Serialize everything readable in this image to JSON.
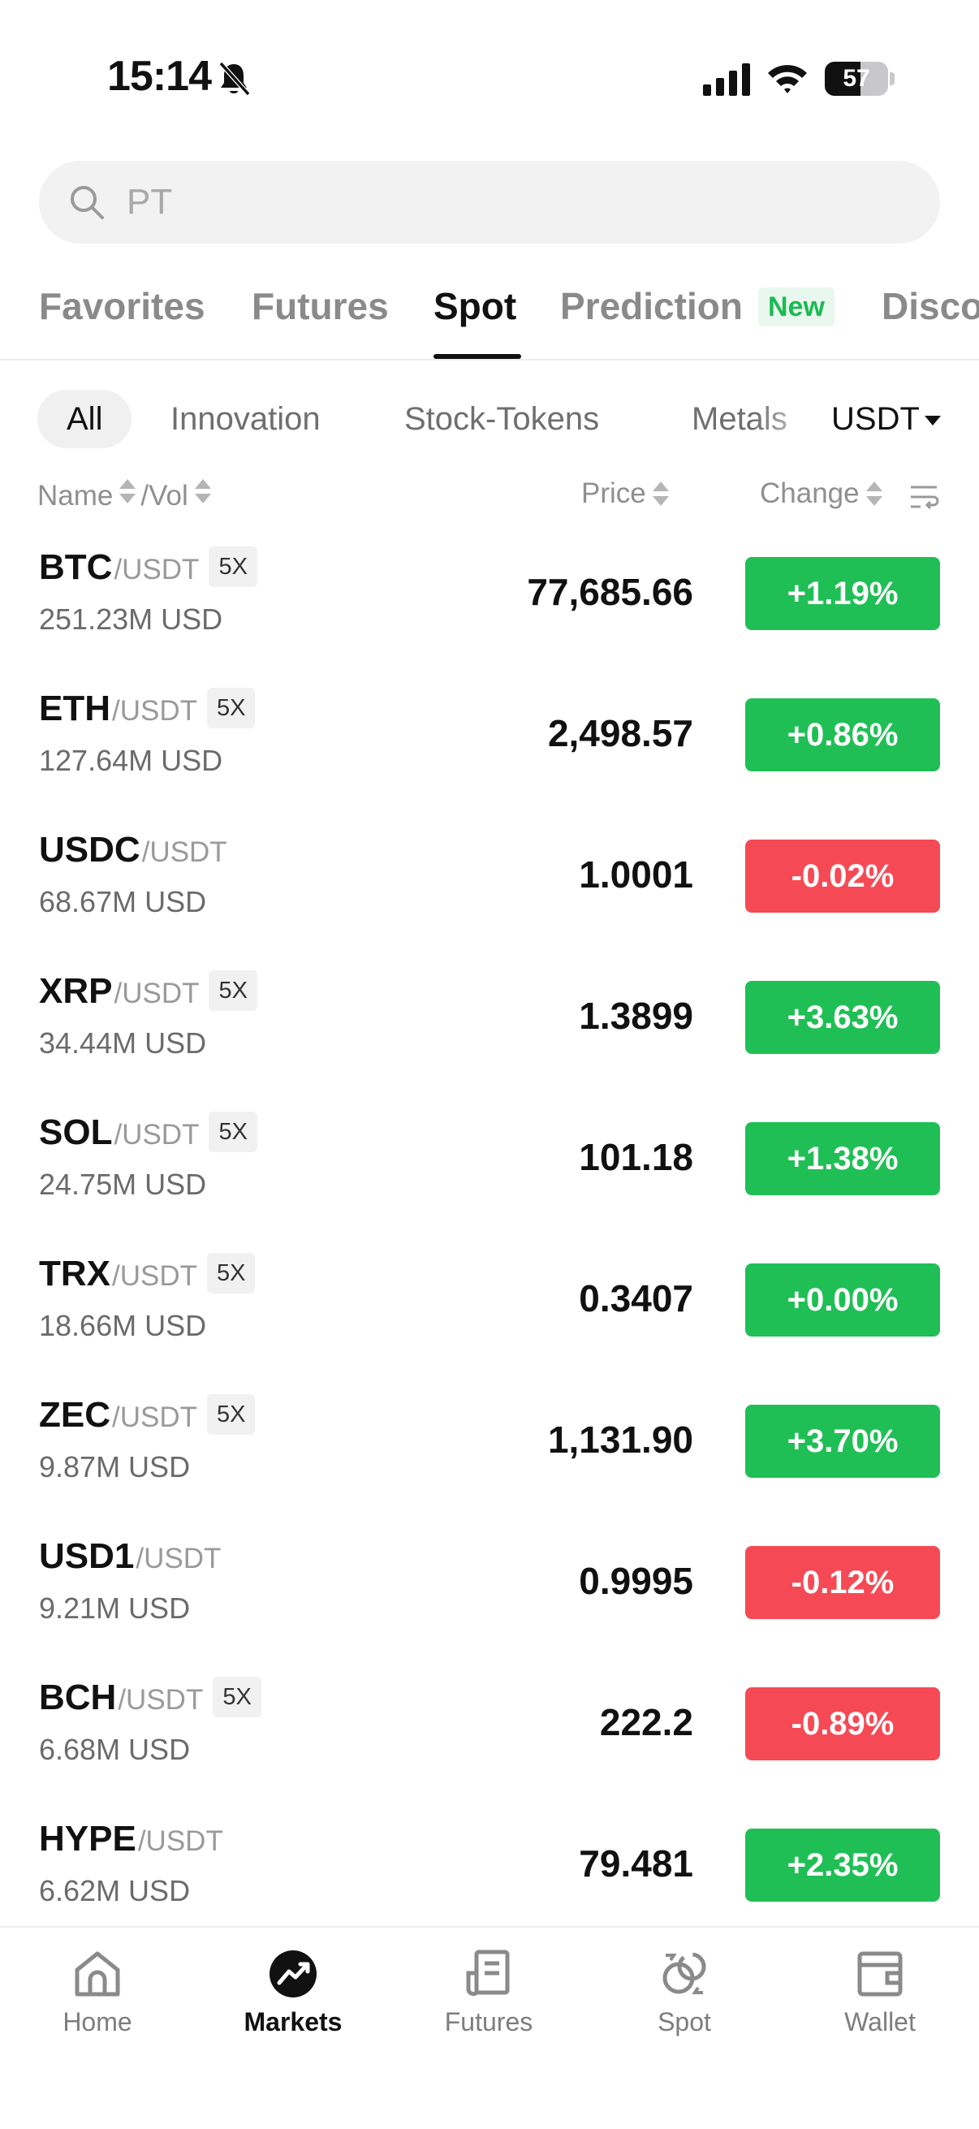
{
  "status_bar": {
    "time": "15:14",
    "battery": "57",
    "battery_level": 0.57
  },
  "search": {
    "placeholder": "PT"
  },
  "main_tabs": [
    {
      "label": "Favorites"
    },
    {
      "label": "Futures"
    },
    {
      "label": "Spot",
      "active": true
    },
    {
      "label": "Prediction",
      "badge": "New"
    },
    {
      "label": "Discover"
    }
  ],
  "sub_tabs": [
    {
      "label": "All",
      "active": true
    },
    {
      "label": "Innovation"
    },
    {
      "label": "Stock-Tokens"
    },
    {
      "label": "Metals"
    }
  ],
  "quote_currency": "USDT",
  "columns": {
    "name": "Name",
    "vol": "/Vol",
    "price": "Price",
    "change": "Change"
  },
  "rows": [
    {
      "base": "BTC",
      "quote": "/USDT",
      "leverage": "5X",
      "volume": "251.23M USD",
      "price": "77,685.66",
      "change": "+1.19%",
      "direction": "up"
    },
    {
      "base": "ETH",
      "quote": "/USDT",
      "leverage": "5X",
      "volume": "127.64M USD",
      "price": "2,498.57",
      "change": "+0.86%",
      "direction": "up"
    },
    {
      "base": "USDC",
      "quote": "/USDT",
      "leverage": "",
      "volume": "68.67M USD",
      "price": "1.0001",
      "change": "-0.02%",
      "direction": "down"
    },
    {
      "base": "XRP",
      "quote": "/USDT",
      "leverage": "5X",
      "volume": "34.44M USD",
      "price": "1.3899",
      "change": "+3.63%",
      "direction": "up"
    },
    {
      "base": "SOL",
      "quote": "/USDT",
      "leverage": "5X",
      "volume": "24.75M USD",
      "price": "101.18",
      "change": "+1.38%",
      "direction": "up"
    },
    {
      "base": "TRX",
      "quote": "/USDT",
      "leverage": "5X",
      "volume": "18.66M USD",
      "price": "0.3407",
      "change": "+0.00%",
      "direction": "up"
    },
    {
      "base": "ZEC",
      "quote": "/USDT",
      "leverage": "5X",
      "volume": "9.87M USD",
      "price": "1,131.90",
      "change": "+3.70%",
      "direction": "up"
    },
    {
      "base": "USD1",
      "quote": "/USDT",
      "leverage": "",
      "volume": "9.21M USD",
      "price": "0.9995",
      "change": "-0.12%",
      "direction": "down"
    },
    {
      "base": "BCH",
      "quote": "/USDT",
      "leverage": "5X",
      "volume": "6.68M USD",
      "price": "222.2",
      "change": "-0.89%",
      "direction": "down"
    },
    {
      "base": "HYPE",
      "quote": "/USDT",
      "leverage": "",
      "volume": "6.62M USD",
      "price": "79.481",
      "change": "+2.35%",
      "direction": "up"
    }
  ],
  "bottom_nav": [
    {
      "label": "Home",
      "icon": "home-icon"
    },
    {
      "label": "Markets",
      "icon": "markets-icon",
      "active": true
    },
    {
      "label": "Futures",
      "icon": "futures-icon"
    },
    {
      "label": "Spot",
      "icon": "spot-icon"
    },
    {
      "label": "Wallet",
      "icon": "wallet-icon"
    }
  ],
  "colors": {
    "up": "#20bf55",
    "down": "#f54a55",
    "new_badge": "#1db954"
  }
}
